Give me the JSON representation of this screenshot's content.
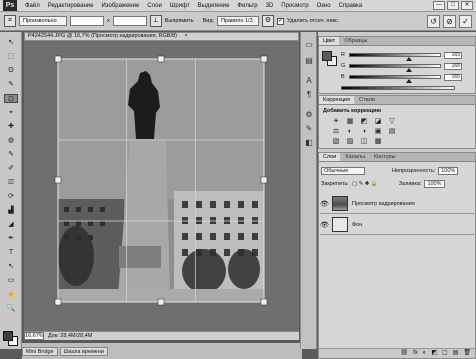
{
  "app": {
    "logo": "Ps"
  },
  "menu": [
    "Файл",
    "Редактирование",
    "Изображение",
    "Слои",
    "Шрифт",
    "Выделение",
    "Фильтр",
    "3D",
    "Просмотр",
    "Окно",
    "Справка"
  ],
  "window_buttons": [
    "—",
    "□",
    "✕"
  ],
  "options": {
    "preset": "Произвольно",
    "x_sep": "х",
    "straighten": "Выпрямить",
    "view_label": "Вид:",
    "view_value": "Правило 1/3",
    "delete_label": "Удалить отсеч. пикс.",
    "delete_mark": "✓",
    "cancel": "⊘",
    "commit": "✓",
    "reset": "↺"
  },
  "document": {
    "tab_title": "P4242544.JPG @ 16,7% (Просмотр кадрирования, RGB/8)",
    "tab_close": "×",
    "zoom": "16,67%",
    "doc_info": "Док: 28,4М/28,4М"
  },
  "bottom_tabs": [
    "Mini Bridge",
    "Шкала времени"
  ],
  "color_panel": {
    "tabs": [
      "Цвет",
      "Образцы"
    ],
    "sliders": [
      {
        "label": "R",
        "value": "165",
        "position": 0.64
      },
      {
        "label": "G",
        "value": "165",
        "position": 0.64
      },
      {
        "label": "B",
        "value": "165",
        "position": 0.64
      }
    ]
  },
  "adjustments_panel": {
    "tabs": [
      "Коррекция",
      "Стили"
    ],
    "title": "Добавить коррекцию",
    "row1": [
      "☀",
      "▦",
      "◩",
      "◪",
      "▽"
    ],
    "row2": [
      "⚖",
      "◐",
      "◑",
      "▣",
      "▤"
    ],
    "row3": [
      "▧",
      "▨",
      "◫",
      "▩"
    ]
  },
  "layers_panel": {
    "tabs": [
      "Слои",
      "Каналы",
      "Контуры"
    ],
    "kind": "Обычные",
    "opacity_label": "Непрозрачность:",
    "opacity_value": "100%",
    "lock_label": "Закрепить:",
    "fill_label": "Заливка:",
    "fill_value": "100%",
    "layers": [
      {
        "name": "Просмотр кадрирования",
        "selected": false
      },
      {
        "name": "Фон",
        "selected": false
      }
    ],
    "footer_icons": [
      "⛓",
      "fx",
      "◐",
      "◩",
      "▢",
      "▤",
      "🗑"
    ]
  },
  "tools": [
    "↖",
    "⬚",
    "ʘ",
    "✎",
    "⊡",
    "⌖",
    "✚",
    "◍",
    "✎",
    "✐",
    "⎚",
    "⟳",
    "▟",
    "◢",
    "✒",
    "T",
    "↖",
    "▭",
    "☝",
    "🔍"
  ],
  "dock_icons": [
    "▭",
    "▤",
    "A",
    "¶",
    "⚙",
    "✎",
    "◧"
  ]
}
